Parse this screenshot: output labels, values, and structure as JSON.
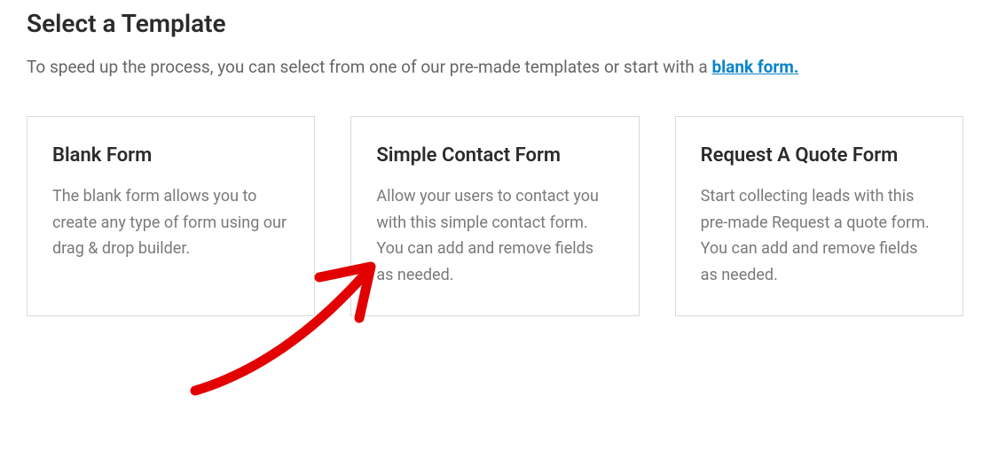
{
  "page": {
    "title": "Select a Template",
    "intro_prefix": "To speed up the process, you can select from one of our pre-made templates or start with a ",
    "intro_link_text": "blank form."
  },
  "templates": [
    {
      "title": "Blank Form",
      "description": "The blank form allows you to create any type of form using our drag & drop builder."
    },
    {
      "title": "Simple Contact Form",
      "description": "Allow your users to contact you with this simple contact form. You can add and remove fields as needed."
    },
    {
      "title": "Request A Quote Form",
      "description": "Start collecting leads with this pre-made Request a quote form. You can add and remove fields as needed."
    }
  ]
}
